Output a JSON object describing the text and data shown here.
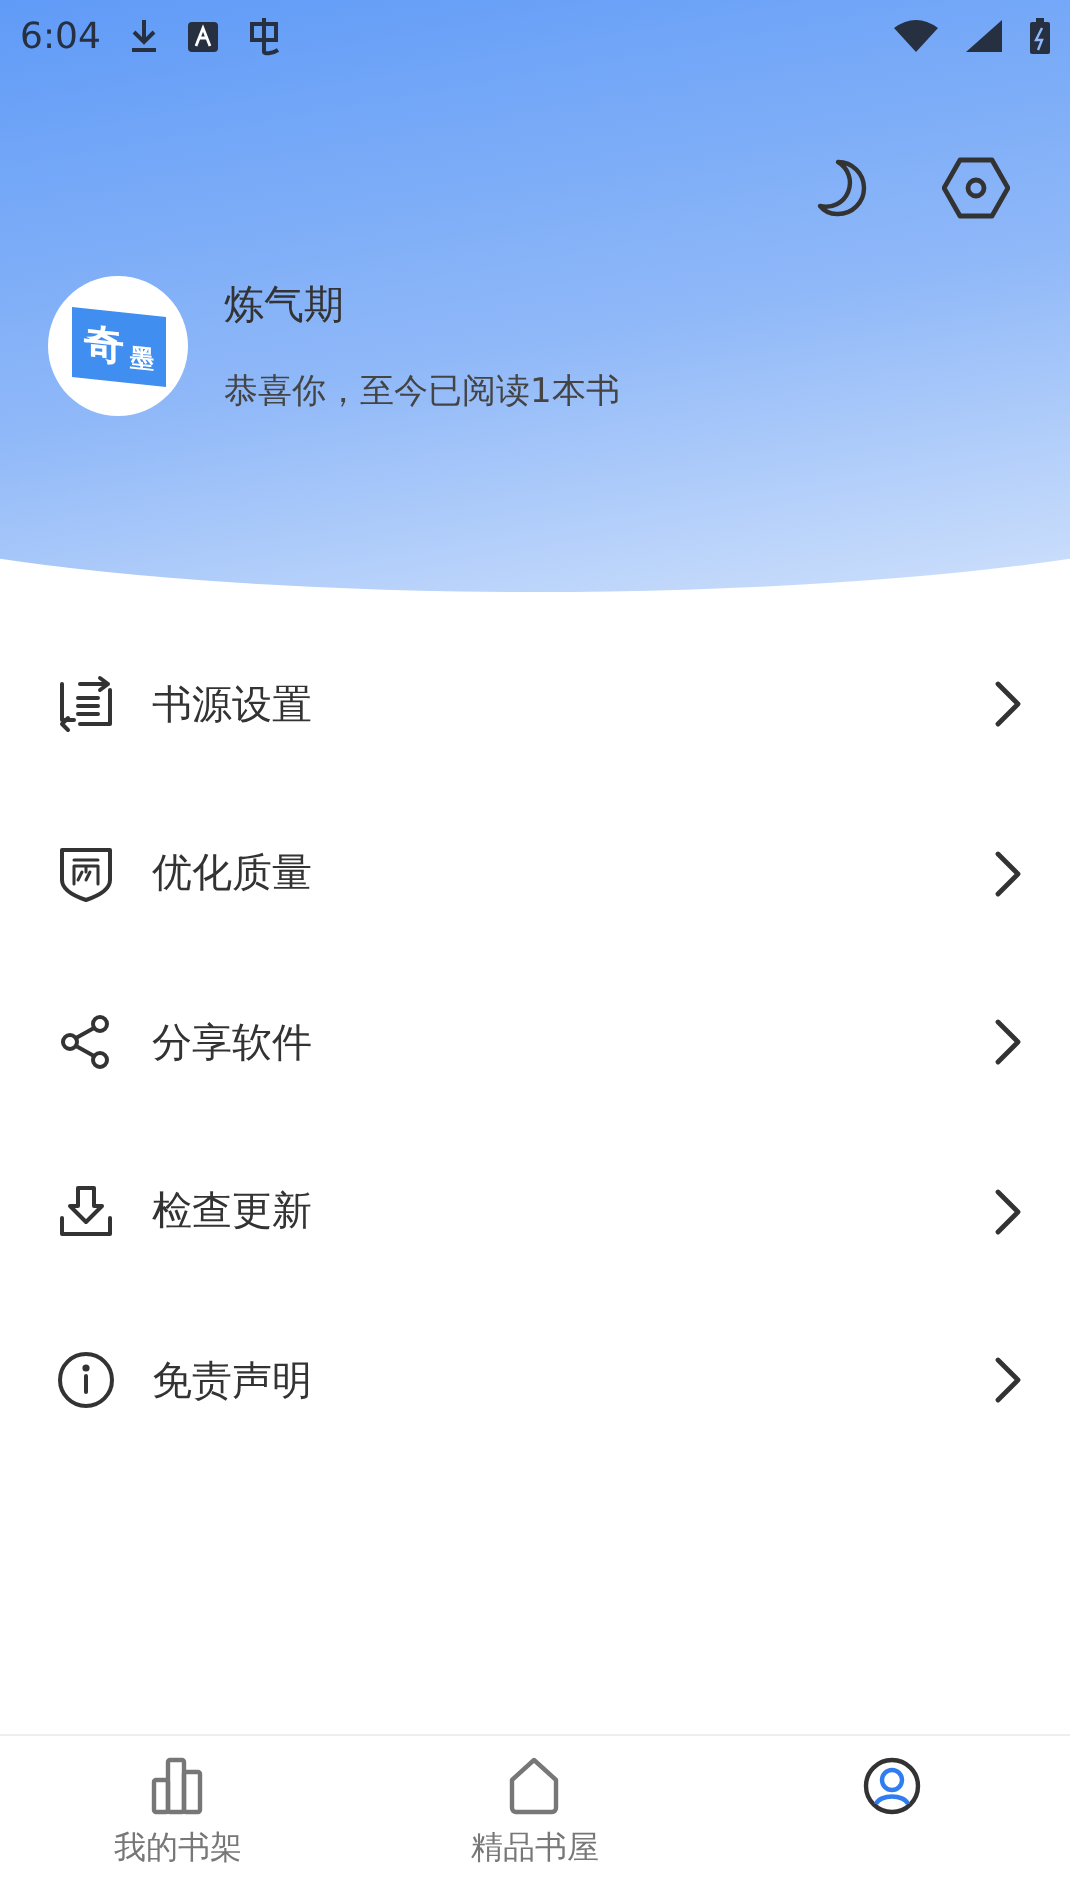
{
  "status_bar": {
    "time": "6:04"
  },
  "profile": {
    "avatar_text": [
      "奇",
      "墨"
    ],
    "name": "炼气期",
    "subtitle": "恭喜你，至今已阅读1本书"
  },
  "menu": [
    {
      "kind": "source",
      "label": "书源设置"
    },
    {
      "kind": "quality",
      "label": "优化质量"
    },
    {
      "kind": "share",
      "label": "分享软件"
    },
    {
      "kind": "update",
      "label": "检查更新"
    },
    {
      "kind": "info",
      "label": "免责声明"
    }
  ],
  "tabs": [
    {
      "kind": "shelf",
      "label": "我的书架",
      "selected": false
    },
    {
      "kind": "home",
      "label": "精品书屋",
      "selected": false
    },
    {
      "kind": "user",
      "selected": true
    }
  ]
}
